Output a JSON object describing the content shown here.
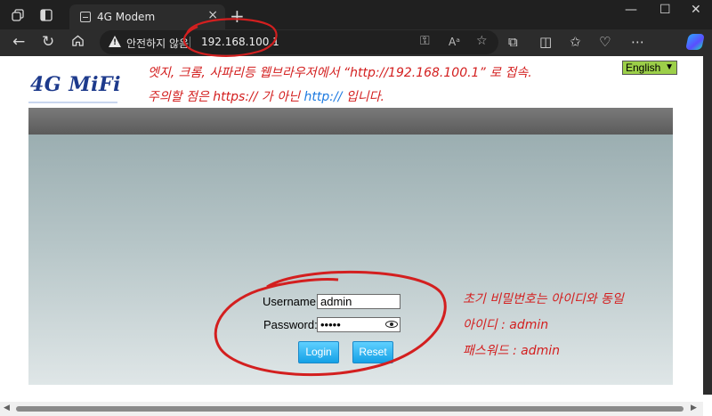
{
  "browser": {
    "tab_title": "4G Modem",
    "insecure_label": "안전하지 않음",
    "url": "192.168.100.1",
    "new_tab": "+",
    "close_tab": "×",
    "window_minimize": "—",
    "window_maximize": "☐",
    "window_close": "✕"
  },
  "page": {
    "logo": "4G MiFi",
    "language": "English",
    "username_label": "Username:",
    "username_value": "admin",
    "password_label": "Password:",
    "password_value": "•••••",
    "login_button": "Login",
    "reset_button": "Reset"
  },
  "annotations": {
    "line1": "엣지, 크롬, 사파리등 웹브라우저에서 “http://192.168.100.1” 로 접속.",
    "line2_a": "주의할 점은 https:// 가 아닌 ",
    "line2_b": "http://",
    "line2_c": " 입니다.",
    "side1": "초기 비밀번호는 아이디와 동일",
    "side2": "아이디 : admin",
    "side3": "패스워드 : admin"
  },
  "colors": {
    "annotation_red": "#d31f1f",
    "annotation_blue": "#1f7be0",
    "button_blue": "#14a1e6",
    "language_green": "#9ccf49",
    "logo_blue": "#1d3a8c"
  }
}
